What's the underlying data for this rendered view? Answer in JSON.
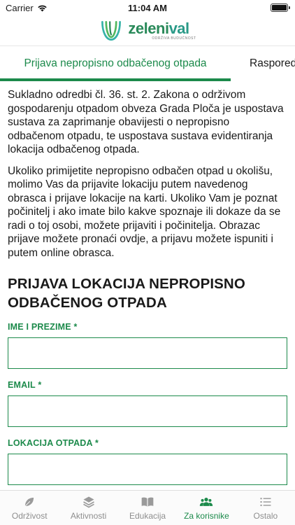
{
  "status": {
    "carrier": "Carrier",
    "time": "11:04 AM",
    "battery_percent": 100
  },
  "header": {
    "logo_word": "zeleni",
    "logo_word_accent": "val",
    "logo_tagline": "ODRŽIVA BUDUĆNOST"
  },
  "tabs": [
    {
      "label": "Prijava nepropisno odbačenog otpada",
      "active": true
    },
    {
      "label": "Raspored",
      "active": false
    }
  ],
  "content": {
    "paragraph_1": "Sukladno odredbi čl. 36. st. 2. Zakona o održivom gospodarenju otpadom obveza Grada Ploča je uspostava sustava za zaprimanje obavijesti o nepropisno odbačenom otpadu, te uspostava sustava evidentiranja lokacija odbačenog otpada.",
    "paragraph_2": "Ukoliko primijetite nepropisno odbačen otpad u okolišu, molimo Vas da prijavite lokaciju putem navedenog obrasca i prijave lokacije na karti. Ukoliko Vam je poznat počinitelj i ako imate bilo kakve spoznaje ili dokaze da se radi o toj osobi, možete prijaviti i počinitelja. Obrazac prijave možete pronaći ovdje, a prijavu možete ispuniti i putem online obrasca.",
    "form_title": "PRIJAVA LOKACIJA NEPROPISNO ODBAČENOG OTPADA"
  },
  "form": {
    "name_label": "IME I PREZIME *",
    "name_value": "",
    "email_label": "EMAIL *",
    "email_value": "",
    "location_label": "LOKACIJA OTPADA *",
    "location_value": ""
  },
  "bottom_nav": {
    "items": [
      {
        "label": "Održivost",
        "icon": "leaf-icon",
        "active": false
      },
      {
        "label": "Aktivnosti",
        "icon": "layers-icon",
        "active": false
      },
      {
        "label": "Edukacija",
        "icon": "book-icon",
        "active": false
      },
      {
        "label": "Za korisnike",
        "icon": "users-icon",
        "active": true
      },
      {
        "label": "Ostalo",
        "icon": "list-icon",
        "active": false
      }
    ]
  },
  "colors": {
    "accent": "#1c8a4b",
    "inactive": "#8e8e8e",
    "logo_teal": "#2a9a88"
  }
}
